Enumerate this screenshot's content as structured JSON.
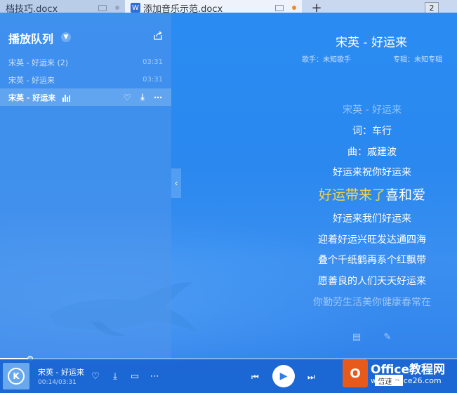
{
  "tabs": [
    {
      "label": "档技巧.docx"
    },
    {
      "label": "添加音乐示范.docx"
    }
  ],
  "tab_count": "2",
  "queue": {
    "title": "播放队列",
    "items": [
      {
        "name": "宋英 - 好运来 (2)",
        "duration": "03:31"
      },
      {
        "name": "宋英 - 好运来",
        "duration": "03:31"
      },
      {
        "name": "宋英 - 好运来",
        "duration": ""
      }
    ]
  },
  "song": {
    "title": "宋英 - 好运来",
    "singer": "歌手：未知歌手",
    "album": "专辑：未知专辑"
  },
  "lyrics": {
    "lines": [
      "宋英 - 好运来",
      "词：车行",
      "曲：戚建波",
      "好运来祝你好运来",
      "",
      "好运来我们好运来",
      "迎着好运兴旺发达通四海",
      "叠个千纸鹤再系个红飘带",
      "愿善良的人们天天好运来",
      "你勤劳生活美你健康春常在"
    ],
    "current_highlight": "好运带来了",
    "current_rest": "喜和爱"
  },
  "now_playing": {
    "title": "宋英 - 好运来",
    "time": "00:14/03:31",
    "progress": 0.066
  },
  "speed_label": "倍速 ^",
  "watermark": {
    "logo_letter": "O",
    "title": "Office教程网",
    "url": "www.office26.com"
  }
}
